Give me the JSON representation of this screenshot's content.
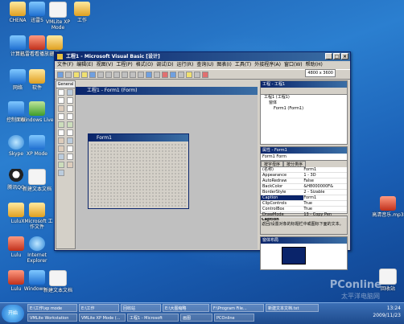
{
  "desktop": {
    "icons": [
      {
        "label": "CHENA"
      },
      {
        "label": "迅雷5"
      },
      {
        "label": "VMLite XP Mode"
      },
      {
        "label": "工作"
      },
      {
        "label": "计算机"
      },
      {
        "label": "迅雷看看播放器"
      },
      {
        "label": "迅雷"
      },
      {
        "label": "网络"
      },
      {
        "label": "软件"
      },
      {
        "label": "控制面板"
      },
      {
        "label": "Windows Live"
      },
      {
        "label": "Skype"
      },
      {
        "label": "XP Mode"
      },
      {
        "label": "腾讯QQ"
      },
      {
        "label": "新建文本文档"
      },
      {
        "label": "Lulu"
      },
      {
        "label": "XMicrosoft 工作文件"
      },
      {
        "label": "Lulu"
      },
      {
        "label": "Internet Explorer"
      },
      {
        "label": "Lulu"
      },
      {
        "label": "Windows..."
      },
      {
        "label": "新建文本文档"
      },
      {
        "label": "高清音乐.mp3"
      },
      {
        "label": "回收站"
      }
    ]
  },
  "vb": {
    "title": "工程1 - Microsoft Visual Basic [设计]",
    "menu": [
      "文件(F)",
      "编辑(E)",
      "视图(V)",
      "工程(P)",
      "格式(O)",
      "调试(D)",
      "运行(R)",
      "查询(U)",
      "图表(I)",
      "工具(T)",
      "外接程序(A)",
      "窗口(W)",
      "帮助(H)"
    ],
    "coords": "4800 x 3600",
    "toolbox_title": "General",
    "child_title": "工程1 - Form1 (Form)",
    "form_title": "Form1",
    "project": {
      "title": "工程 - 工程1",
      "tree": [
        "工程1 (工程1)",
        "窗体",
        "Form1 (Form1)"
      ]
    },
    "props": {
      "title": "属性 - Form1",
      "combo": "Form1 Form",
      "tabs": [
        "按字母序",
        "按分类序"
      ],
      "rows": [
        [
          "(名称)",
          "Form1"
        ],
        [
          "Appearance",
          "1 - 3D"
        ],
        [
          "AutoRedraw",
          "False"
        ],
        [
          "BackColor",
          "&H8000000F&"
        ],
        [
          "BorderStyle",
          "2 - Sizable"
        ],
        [
          "Caption",
          "Form1"
        ],
        [
          "ClipControls",
          "True"
        ],
        [
          "ControlBox",
          "True"
        ],
        [
          "DrawMode",
          "13 - Copy Pen"
        ]
      ],
      "desc_title": "Caption",
      "desc_text": "返回/设置对象的标题栏中或图标下面的文本。"
    },
    "layout_title": "窗体布局"
  },
  "taskbar": {
    "start": "开始",
    "tasks": [
      "E:\\工作\\xp mode",
      "E:\\工作",
      "回收站",
      "E:\\大图缩略",
      "F:\\Program File...",
      "新建文本文档.txt",
      "VMLite Workstation",
      "VMLite XP Mode (...",
      "工程1 - Microsoft",
      "画图",
      "PCOnline"
    ],
    "time": "13:24",
    "date": "2009/11/23"
  },
  "watermark": {
    "brand": "PConline",
    "sub": "太平洋电脑网"
  }
}
